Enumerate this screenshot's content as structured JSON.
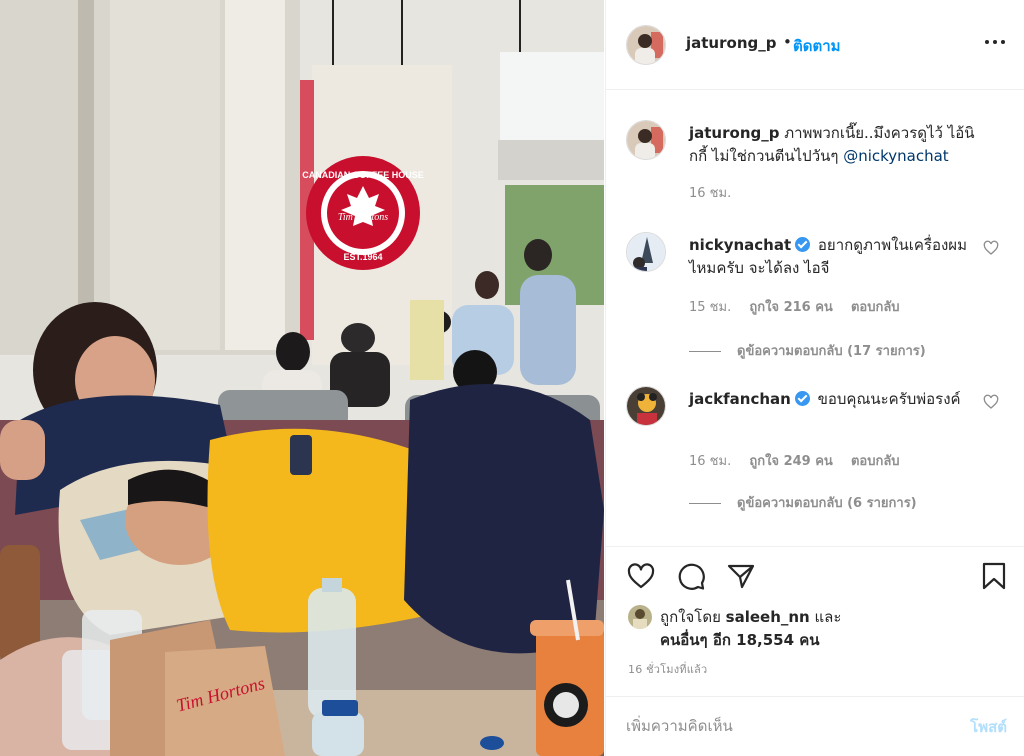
{
  "post": {
    "username": "jaturong_p",
    "follow_separator": "•",
    "follow_label": "ติดตาม",
    "more_icon": "more-horizontal-icon"
  },
  "photo": {
    "sign_top_text": "CANADIAN COFFEE HOUSE",
    "sign_logo_text": "Tim Hortons",
    "sign_bottom_text": "EST.1964",
    "bag_text": "Tim Hortons",
    "accent_red": "#c8102e",
    "shirt_yellow": "#f5b81c"
  },
  "caption": {
    "username": "jaturong_p",
    "text": "ภาพพวกเนี๊ย..มึงควรดูไว้ ไอ้นิกกี้ ไม่ใช่กวนตีนไปวันๆ",
    "mention": "@nickynachat",
    "time": "16 ชม."
  },
  "comments": [
    {
      "username": "nickynachat",
      "verified": true,
      "text": "อยากดูภาพในเครื่องผมไหมครับ จะได้ลง ไอจี",
      "time": "15 ชม.",
      "likes": "ถูกใจ 216 คน",
      "reply_label": "ตอบกลับ",
      "view_replies": "ดูข้อความตอบกลับ (17 รายการ)"
    },
    {
      "username": "jackfanchan",
      "verified": true,
      "text": "ขอบคุณนะครับพ่อรงค์",
      "time": "16 ชม.",
      "likes": "ถูกใจ 249 คน",
      "reply_label": "ตอบกลับ",
      "view_replies": "ดูข้อความตอบกลับ (6 รายการ)"
    }
  ],
  "actions": {
    "like_icon": "heart-icon",
    "comment_icon": "comment-icon",
    "share_icon": "share-icon",
    "save_icon": "bookmark-icon"
  },
  "likes": {
    "prefix": "ถูกใจโดย",
    "user": "saleeh_nn",
    "conj": "และ",
    "others": "คนอื่นๆ อีก 18,554 คน"
  },
  "timestamp": "16 ชั่วโมงที่แล้ว",
  "add_comment": {
    "placeholder": "เพิ่มความคิดเห็น",
    "post_label": "โพสต์"
  }
}
